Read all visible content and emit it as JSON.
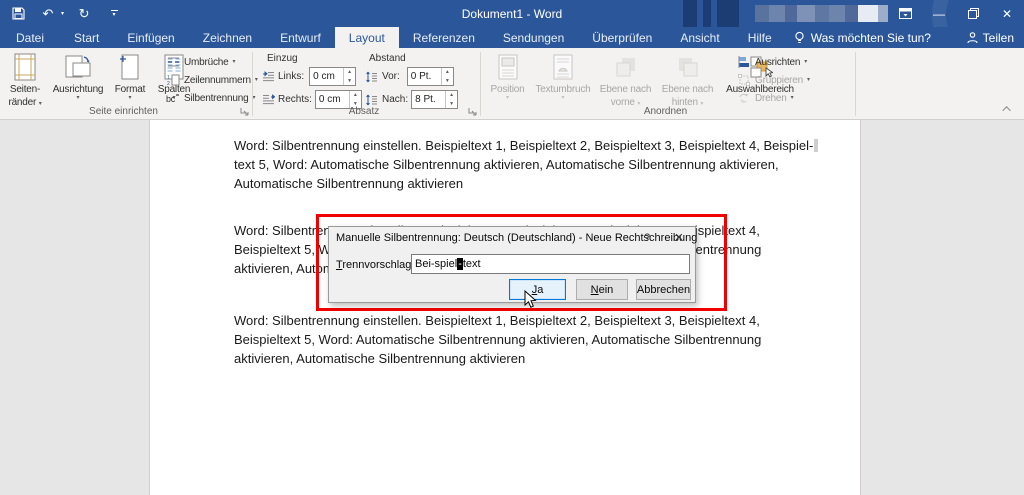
{
  "titlebar": {
    "title": "Dokument1 - Word",
    "save_icon": "floppy-disk",
    "undo_label": "↶",
    "redo_label": "↻",
    "minimize_label": "—",
    "close_label": "✕",
    "share_label": "Teilen"
  },
  "tabs": [
    {
      "label": "Datei"
    },
    {
      "label": "Start"
    },
    {
      "label": "Einfügen"
    },
    {
      "label": "Zeichnen"
    },
    {
      "label": "Entwurf"
    },
    {
      "label": "Layout"
    },
    {
      "label": "Referenzen"
    },
    {
      "label": "Sendungen"
    },
    {
      "label": "Überprüfen"
    },
    {
      "label": "Ansicht"
    },
    {
      "label": "Hilfe"
    }
  ],
  "tellme": "Was möchten Sie tun?",
  "ribbon": {
    "seite": {
      "label": "Seite einrichten",
      "seitenraender_1": "Seiten-",
      "seitenraender_2": "ränder",
      "ausrichtung": "Ausrichtung",
      "format": "Format",
      "spalten": "Spalten",
      "umbrueche": "Umbrüche",
      "zeilennummern": "Zeilennummern",
      "silbentrennung": "Silbentrennung"
    },
    "absatz": {
      "label": "Absatz",
      "einzug": "Einzug",
      "abstand": "Abstand",
      "links_label": "Links:",
      "links_value": "0 cm",
      "rechts_label": "Rechts:",
      "rechts_value": "0 cm",
      "vor_label": "Vor:",
      "vor_value": "0 Pt.",
      "nach_label": "Nach:",
      "nach_value": "8 Pt."
    },
    "anordnen": {
      "label": "Anordnen",
      "position": "Position",
      "textumbruch": "Textumbruch",
      "ebene_vorne_1": "Ebene nach",
      "ebene_vorne_2": "vorne",
      "ebene_hinten_1": "Ebene nach",
      "ebene_hinten_2": "hinten",
      "auswahlbereich": "Auswahlbereich",
      "ausrichten": "Ausrichten",
      "gruppieren": "Gruppieren",
      "drehen": "Drehen"
    }
  },
  "document": {
    "paragraph1": {
      "line1": "Word: Silbentrennung einstellen. Beispieltext 1, Beispieltext 2, Beispieltext 3, Beispieltext 4, Beispiel-",
      "line2": "text 5, Word: Automatische Silbentrennung aktivieren, Automatische Silbentrennung aktivieren,",
      "line3": "Automatische Silbentrennung aktivieren"
    },
    "paragraph2": {
      "line1": "Word: Silbentrennung einstellen. Beispieltext 1, Beispieltext 2, Beispieltext 3, Beispieltext 4,",
      "line2": "Beispieltext 5, Word: Automatische Silbentrennung aktivieren, Automatische Silbentrennung",
      "line3": "aktivieren, Automatische Silbentrennung aktivieren"
    },
    "paragraph3": {
      "line1": "Word: Silbentrennung einstellen. Beispieltext 1, Beispieltext 2, Beispieltext 3, Beispieltext 4,",
      "line2": "Beispieltext 5, Word: Automatische Silbentrennung aktivieren, Automatische Silbentrennung",
      "line3": "aktivieren, Automatische Silbentrennung aktivieren"
    }
  },
  "dialog": {
    "title": "Manuelle Silbentrennung: Deutsch (Deutschland) - Neue Rechtschreibung",
    "help_label": "?",
    "close_label": "✕",
    "field_label_u": "T",
    "field_label_rest": "rennvorschlag:",
    "value_before": "Bei-spiel",
    "value_selected": "-",
    "value_after": "text",
    "ja_u": "J",
    "ja_rest": "a",
    "nein_u": "N",
    "nein_rest": "ein",
    "abbrechen": "Abbrechen"
  },
  "colors": {
    "accent_blue": "#2b579a",
    "highlight_red": "#f20000",
    "focus_blue": "#0078d7",
    "ribbon_bg": "#f3f2f1"
  }
}
